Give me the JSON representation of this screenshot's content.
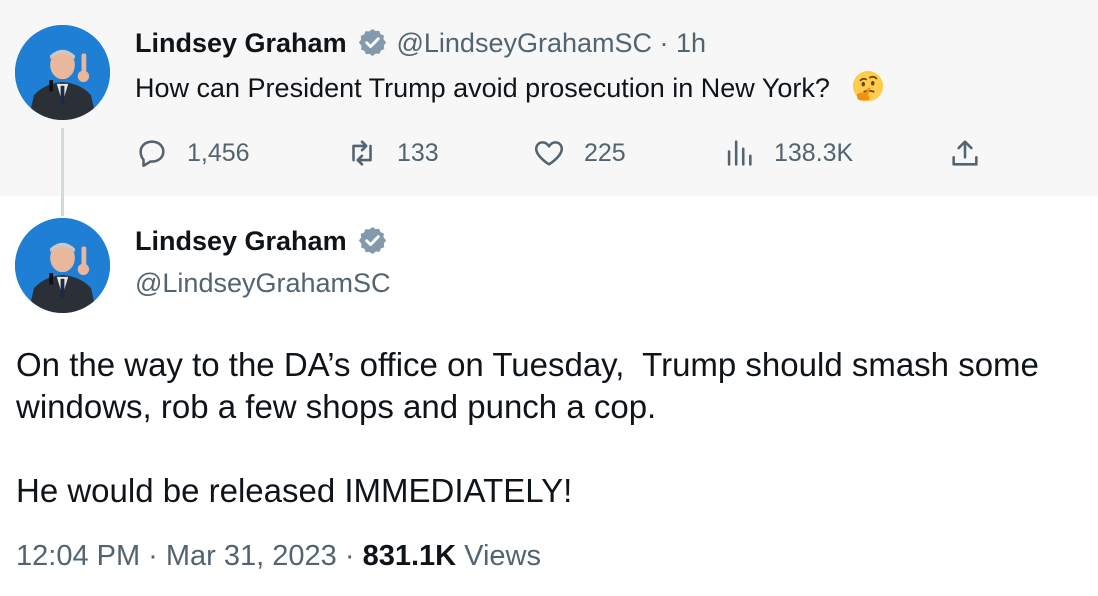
{
  "parent_tweet": {
    "author_name": "Lindsey Graham",
    "handle_time": "@LindseyGrahamSC · 1h",
    "text": "How can President Trump avoid prosecution in New York?",
    "emoji": "thinking-face",
    "actions": {
      "replies": "1,456",
      "retweets": "133",
      "likes": "225",
      "views": "138.3K"
    }
  },
  "main_tweet": {
    "author_name": "Lindsey Graham",
    "handle": "@LindseyGrahamSC",
    "text": "On the way to the DA’s office on Tuesday,  Trump should smash some\nwindows, rob a few shops and punch a cop.\n\nHe would be released IMMEDIATELY!",
    "time_date": "12:04 PM · Mar 31, 2023 · ",
    "views_count": "831.1K",
    "views_label": " Views"
  },
  "colors": {
    "verified_badge": "#829aab",
    "muted_text": "#536471",
    "parent_background": "#f7f7f7"
  }
}
